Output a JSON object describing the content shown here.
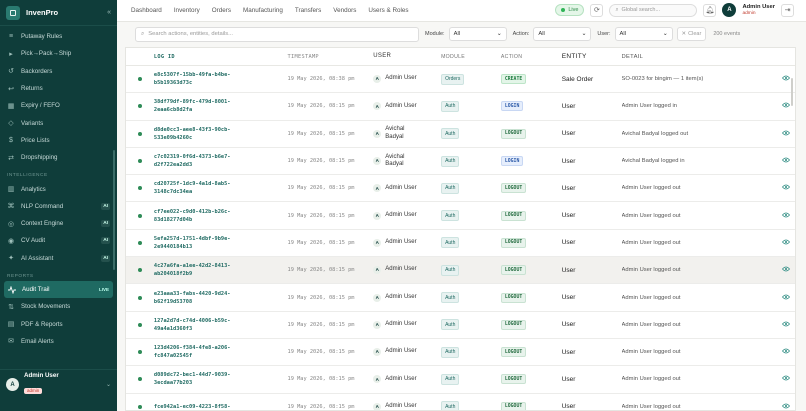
{
  "app": {
    "name": "InvenPro"
  },
  "sidebar": {
    "items_top": [
      {
        "label": "Putaway Rules",
        "icon": "rules-icon"
      },
      {
        "label": "Pick→Pack→Ship",
        "icon": "truck-icon"
      },
      {
        "label": "Backorders",
        "icon": "backorder-icon"
      },
      {
        "label": "Returns",
        "icon": "return-icon"
      },
      {
        "label": "Expiry / FEFO",
        "icon": "calendar-icon"
      },
      {
        "label": "Variants",
        "icon": "tag-icon"
      },
      {
        "label": "Price Lists",
        "icon": "price-icon"
      },
      {
        "label": "Dropshipping",
        "icon": "ship-icon"
      }
    ],
    "section_intelligence": "INTELLIGENCE",
    "items_intel": [
      {
        "label": "Analytics",
        "icon": "chart-icon",
        "ai": ""
      },
      {
        "label": "NLP Command",
        "icon": "command-icon",
        "ai": "AI"
      },
      {
        "label": "Context Engine",
        "icon": "engine-icon",
        "ai": "AI"
      },
      {
        "label": "CV Audit",
        "icon": "camera-icon",
        "ai": "AI"
      },
      {
        "label": "AI Assistant",
        "icon": "assistant-icon",
        "ai": "AI"
      }
    ],
    "section_reports": "REPORTS",
    "active_item": {
      "label": "Audit Trail",
      "badge": "LIVE"
    },
    "items_reports": [
      {
        "label": "Stock Movements",
        "icon": "movement-icon"
      },
      {
        "label": "PDF & Reports",
        "icon": "pdf-icon"
      },
      {
        "label": "Email Alerts",
        "icon": "mail-icon"
      }
    ],
    "user": {
      "initial": "A",
      "name": "Admin User",
      "role": "admin"
    }
  },
  "topnav": [
    "Dashboard",
    "Inventory",
    "Orders",
    "Manufacturing",
    "Transfers",
    "Vendors",
    "Users & Roles"
  ],
  "topbar": {
    "live_label": "Live",
    "search_placeholder": "Global search...",
    "user_initial": "A",
    "user_name": "Admin User",
    "user_role": "admin"
  },
  "filters": {
    "search_placeholder": "Search actions, entities, details...",
    "module_label": "Module:",
    "module_value": "All",
    "action_label": "Action:",
    "action_value": "All",
    "user_label": "User:",
    "user_value": "All",
    "clear_label": "Clear",
    "count_text": "200 events"
  },
  "table": {
    "headers": [
      "LOG ID",
      "TIMESTAMP",
      "USER",
      "MODULE",
      "ACTION",
      "ENTITY",
      "DETAIL"
    ],
    "rows": [
      {
        "id1": "e8c5307f-15bb-49fa-b4be-",
        "id2": "b5b19363d73c",
        "ts": "19 May 2026, 08:38 pm",
        "ui": "A",
        "user1": "Admin User",
        "user2": "",
        "module": "Orders",
        "action": "CREATE",
        "kind": "create",
        "entity": "Sale Order",
        "detail": "SO-0023 for bingim — 1 item(s)",
        "hl": false
      },
      {
        "id1": "38df79df-89fc-479d-8001-",
        "id2": "2eaa6cb8d2fa",
        "ts": "19 May 2026, 08:15 pm",
        "ui": "A",
        "user1": "Admin User",
        "user2": "",
        "module": "Auth",
        "action": "LOGIN",
        "kind": "login",
        "entity": "User",
        "detail": "Admin User logged in",
        "hl": false
      },
      {
        "id1": "d8de0cc3-aee8-43f3-90cb-",
        "id2": "533e09b4260c",
        "ts": "19 May 2026, 08:15 pm",
        "ui": "A",
        "user1": "Avichal",
        "user2": "Badyal",
        "module": "Auth",
        "action": "LOGOUT",
        "kind": "logout",
        "entity": "User",
        "detail": "Avichal Badyal logged out",
        "hl": false
      },
      {
        "id1": "c7c02319-0f6d-4373-b6e7-",
        "id2": "d2f722ea2dd3",
        "ts": "19 May 2026, 08:15 pm",
        "ui": "A",
        "user1": "Avichal",
        "user2": "Badyal",
        "module": "Auth",
        "action": "LOGIN",
        "kind": "login",
        "entity": "User",
        "detail": "Avichal Badyal logged in",
        "hl": false
      },
      {
        "id1": "cd20725f-1dc9-4a1d-8ab5-",
        "id2": "3148c7dc34ea",
        "ts": "19 May 2026, 08:15 pm",
        "ui": "A",
        "user1": "Admin User",
        "user2": "",
        "module": "Auth",
        "action": "LOGOUT",
        "kind": "logout",
        "entity": "User",
        "detail": "Admin User logged out",
        "hl": false
      },
      {
        "id1": "cf7ee022-c9d0-412b-b26c-",
        "id2": "83d18277d04b",
        "ts": "19 May 2026, 08:15 pm",
        "ui": "A",
        "user1": "Admin User",
        "user2": "",
        "module": "Auth",
        "action": "LOGOUT",
        "kind": "logout",
        "entity": "User",
        "detail": "Admin User logged out",
        "hl": false
      },
      {
        "id1": "5efa257d-1751-4dbf-9b9e-",
        "id2": "2e9440184b13",
        "ts": "19 May 2026, 08:15 pm",
        "ui": "A",
        "user1": "Admin User",
        "user2": "",
        "module": "Auth",
        "action": "LOGOUT",
        "kind": "logout",
        "entity": "User",
        "detail": "Admin User logged out",
        "hl": false
      },
      {
        "id1": "4c27a6fa-a1ee-42d2-8413-",
        "id2": "ab204018f2b9",
        "ts": "19 May 2026, 08:15 pm",
        "ui": "A",
        "user1": "Admin User",
        "user2": "",
        "module": "Auth",
        "action": "LOGOUT",
        "kind": "logout",
        "entity": "User",
        "detail": "Admin User logged out",
        "hl": true
      },
      {
        "id1": "e23aaa33-fabs-4420-9d24-",
        "id2": "b62f19d53708",
        "ts": "19 May 2026, 08:15 pm",
        "ui": "A",
        "user1": "Admin User",
        "user2": "",
        "module": "Auth",
        "action": "LOGOUT",
        "kind": "logout",
        "entity": "User",
        "detail": "Admin User logged out",
        "hl": false
      },
      {
        "id1": "127a2d7d-c74d-4006-b59c-",
        "id2": "49a4a1d360f3",
        "ts": "19 May 2026, 08:15 pm",
        "ui": "A",
        "user1": "Admin User",
        "user2": "",
        "module": "Auth",
        "action": "LOGOUT",
        "kind": "logout",
        "entity": "User",
        "detail": "Admin User logged out",
        "hl": false
      },
      {
        "id1": "123d4206-f384-4fe8-a206-",
        "id2": "fc847a02545f",
        "ts": "19 May 2026, 08:15 pm",
        "ui": "A",
        "user1": "Admin User",
        "user2": "",
        "module": "Auth",
        "action": "LOGOUT",
        "kind": "logout",
        "entity": "User",
        "detail": "Admin User logged out",
        "hl": false
      },
      {
        "id1": "d089dc72-bec1-44d7-9039-",
        "id2": "3ecdaa77b203",
        "ts": "19 May 2026, 08:15 pm",
        "ui": "A",
        "user1": "Admin User",
        "user2": "",
        "module": "Auth",
        "action": "LOGOUT",
        "kind": "logout",
        "entity": "User",
        "detail": "Admin User logged out",
        "hl": false
      },
      {
        "id1": "fce942a1-ec09-4223-8f58-",
        "id2": "",
        "ts": "19 May 2026, 08:15 pm",
        "ui": "A",
        "user1": "Admin User",
        "user2": "",
        "module": "Auth",
        "action": "LOGOUT",
        "kind": "logout",
        "entity": "User",
        "detail": "Admin User logged out",
        "hl": false
      }
    ]
  },
  "colors": {
    "sidebar_bg": "#0f3d3a",
    "accent": "#1f6a62",
    "live_green": "#2fb457",
    "admin_red": "#c0392b"
  }
}
